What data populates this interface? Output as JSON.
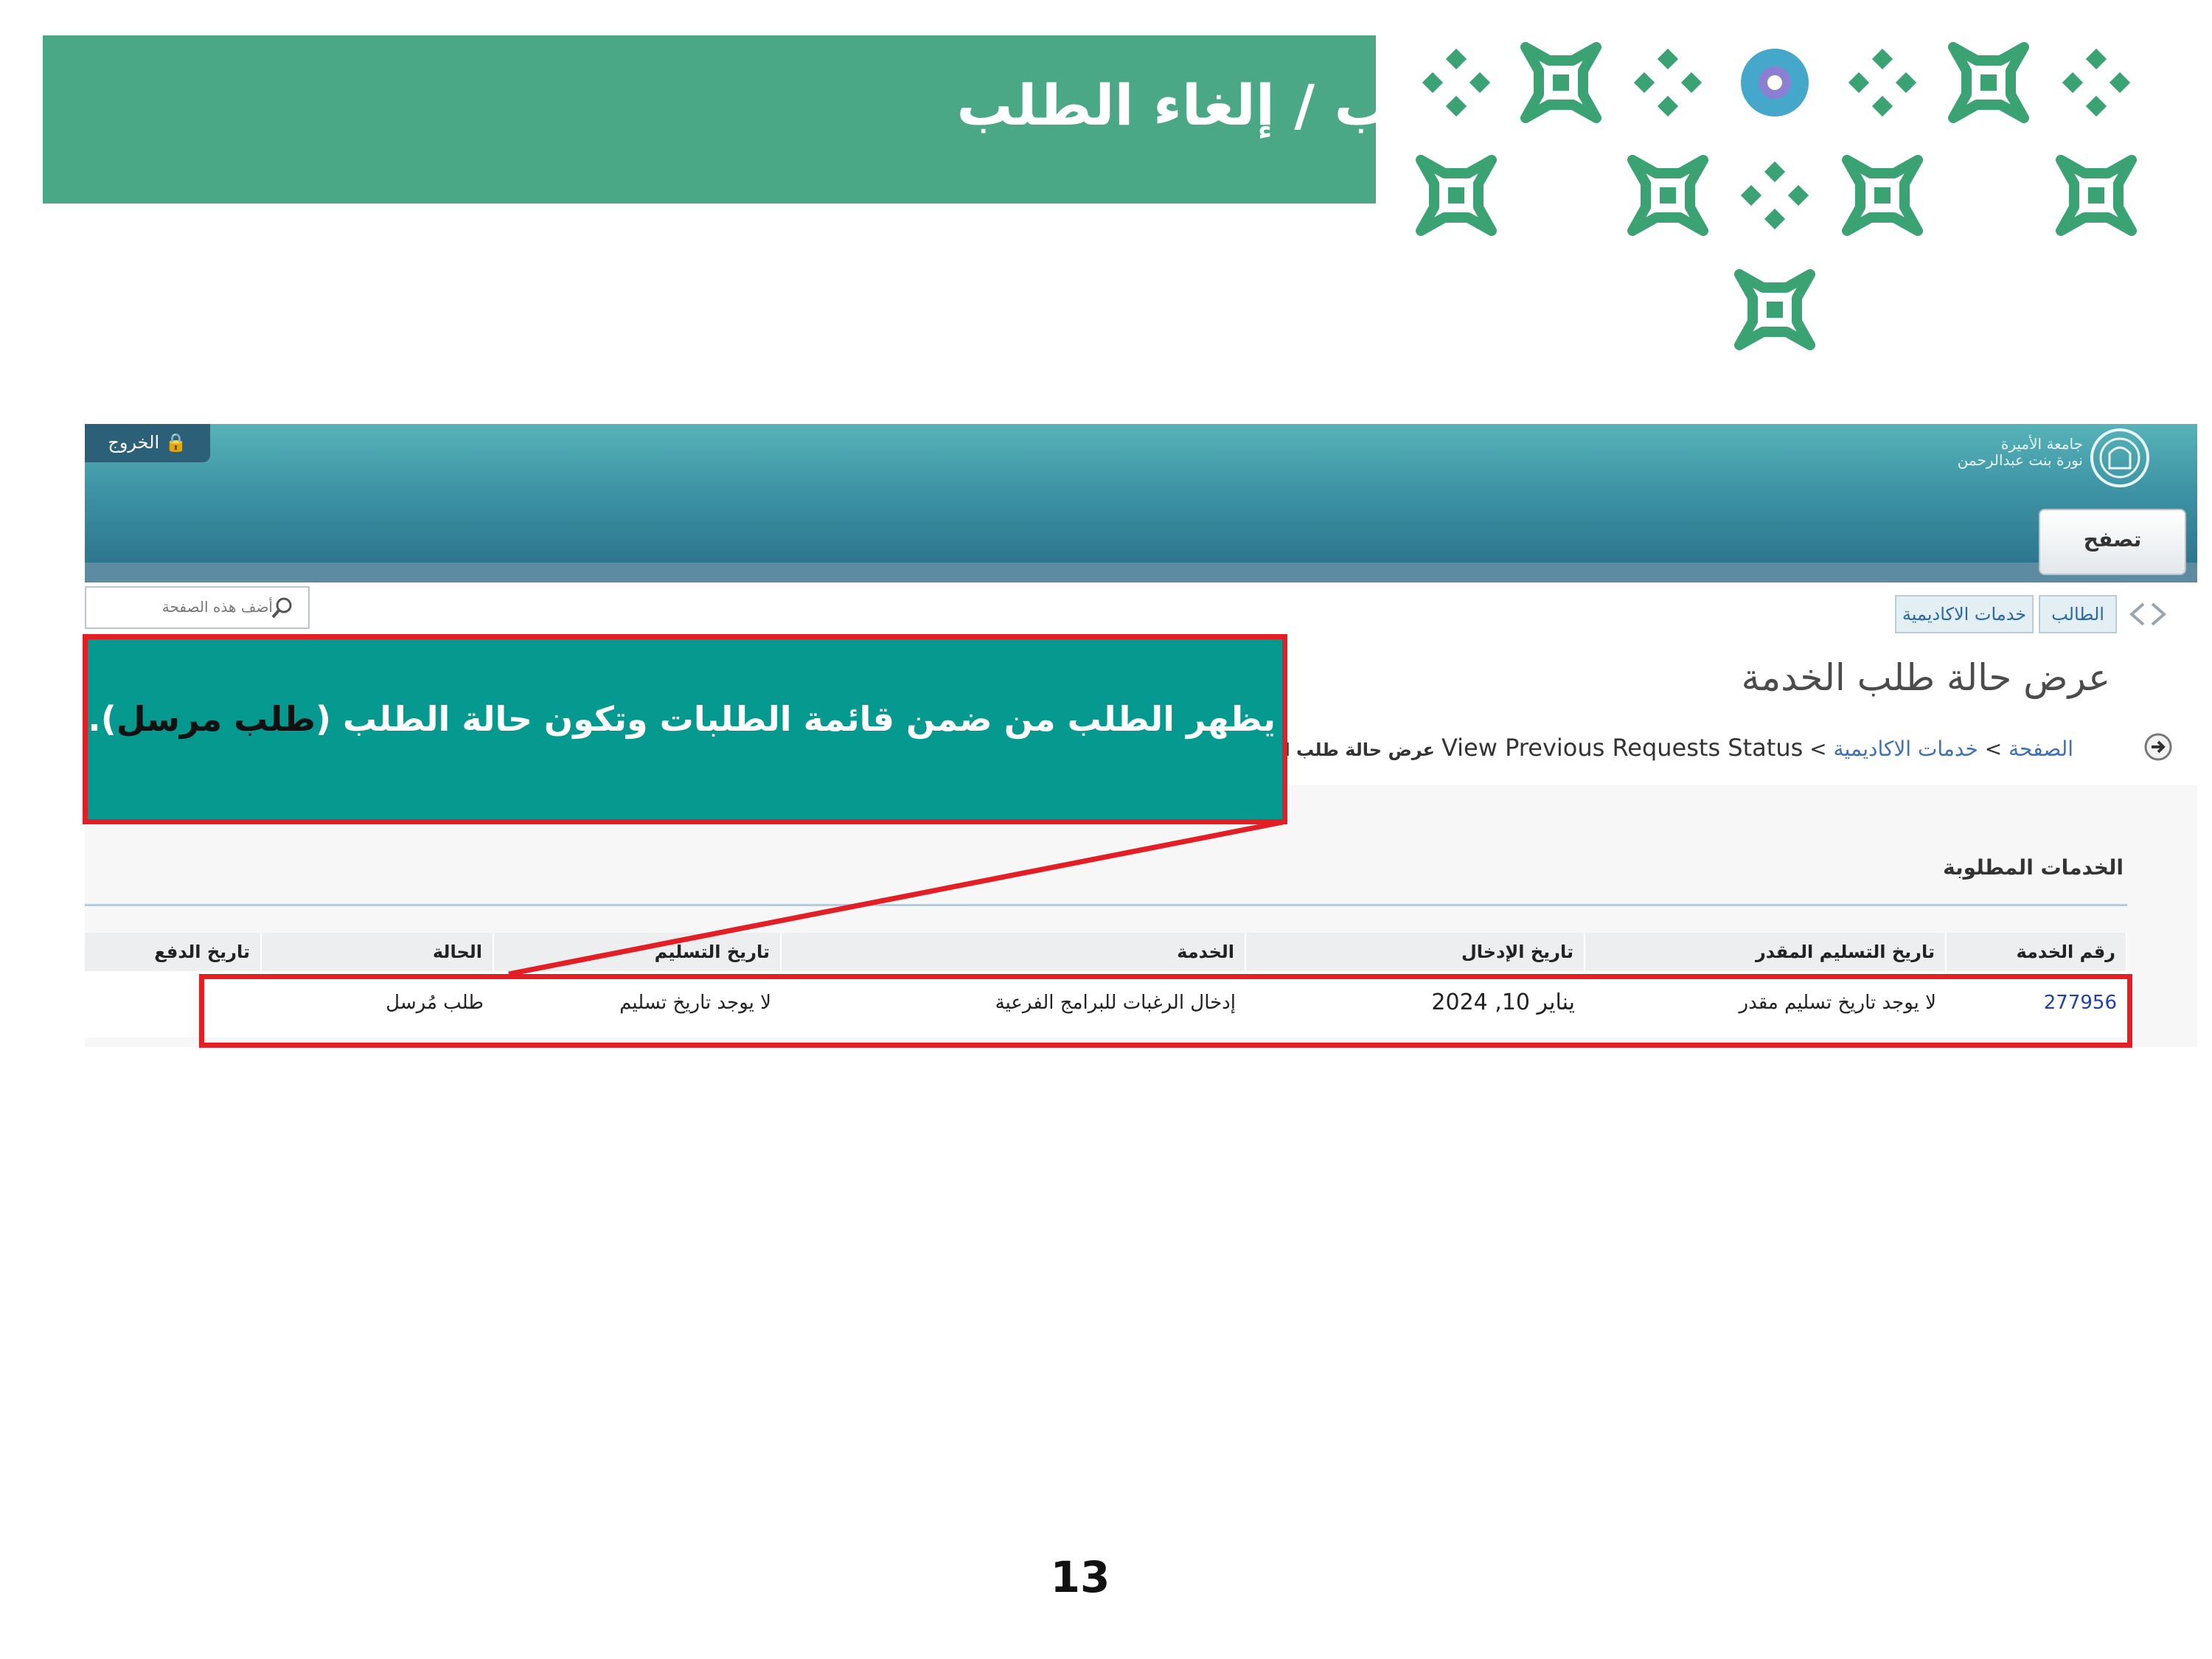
{
  "slide": {
    "title": "خطوات متابعة حالة الطلب / إلغاء الطلب",
    "page_number": "13",
    "colors": {
      "banner": "#4aa886",
      "callout": "#06998f",
      "highlight": "#e31e24"
    }
  },
  "callout": {
    "text_before": "يظهر الطلب من ضمن قائمة الطلبات وتكون حالة الطلب (",
    "emphasis": "طلب مرسل",
    "text_after": ")."
  },
  "header": {
    "logout_label": "الخروج",
    "logo_text_line1": "جامعة الأميرة",
    "logo_text_line2": "نورة بنت عبدالرحمن",
    "browse_label": "تصفح"
  },
  "search": {
    "placeholder": "أضف هذه الصفحة"
  },
  "tabs": [
    {
      "label": "الطالب"
    },
    {
      "label": "خدمات الاكاديمية"
    }
  ],
  "page_title": "عرض حالة طلب الخدمة",
  "breadcrumb": {
    "home": "الصفحة",
    "academic": "خدمات الاكاديمية",
    "current_en": "View Previous Requests Status",
    "current_ar": "عرض حالة طلب الخدمة"
  },
  "section_title": "الخدمات المطلوبة",
  "table": {
    "headers": [
      "رقم الخدمة",
      "تاريخ التسليم المقدر",
      "تاريخ الإدخال",
      "الخدمة",
      "تاريخ التسليم",
      "الحالة",
      "تاريخ الدفع"
    ],
    "rows": [
      [
        "277956",
        "لا يوجد تاريخ تسليم مقدر",
        "يناير 10, 2024",
        "إدخال الرغبات للبرامج الفرعية",
        "لا يوجد تاريخ تسليم",
        "طلب مُرسل",
        ""
      ]
    ]
  }
}
